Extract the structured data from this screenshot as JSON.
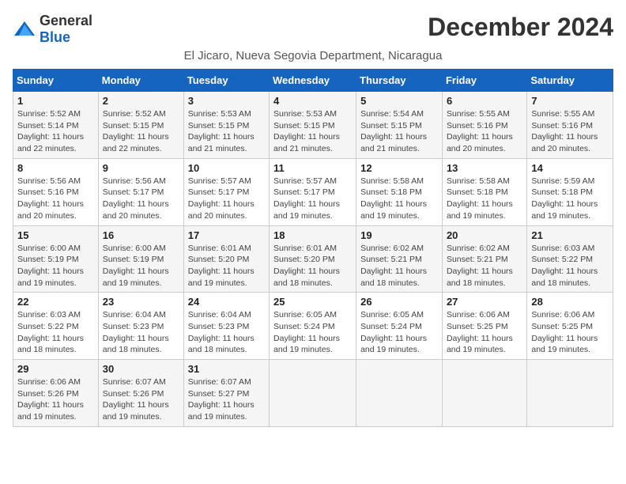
{
  "logo": {
    "general": "General",
    "blue": "Blue"
  },
  "title": "December 2024",
  "subtitle": "El Jicaro, Nueva Segovia Department, Nicaragua",
  "weekdays": [
    "Sunday",
    "Monday",
    "Tuesday",
    "Wednesday",
    "Thursday",
    "Friday",
    "Saturday"
  ],
  "weeks": [
    [
      {
        "day": "1",
        "info": "Sunrise: 5:52 AM\nSunset: 5:14 PM\nDaylight: 11 hours\nand 22 minutes."
      },
      {
        "day": "2",
        "info": "Sunrise: 5:52 AM\nSunset: 5:15 PM\nDaylight: 11 hours\nand 22 minutes."
      },
      {
        "day": "3",
        "info": "Sunrise: 5:53 AM\nSunset: 5:15 PM\nDaylight: 11 hours\nand 21 minutes."
      },
      {
        "day": "4",
        "info": "Sunrise: 5:53 AM\nSunset: 5:15 PM\nDaylight: 11 hours\nand 21 minutes."
      },
      {
        "day": "5",
        "info": "Sunrise: 5:54 AM\nSunset: 5:15 PM\nDaylight: 11 hours\nand 21 minutes."
      },
      {
        "day": "6",
        "info": "Sunrise: 5:55 AM\nSunset: 5:16 PM\nDaylight: 11 hours\nand 20 minutes."
      },
      {
        "day": "7",
        "info": "Sunrise: 5:55 AM\nSunset: 5:16 PM\nDaylight: 11 hours\nand 20 minutes."
      }
    ],
    [
      {
        "day": "8",
        "info": "Sunrise: 5:56 AM\nSunset: 5:16 PM\nDaylight: 11 hours\nand 20 minutes."
      },
      {
        "day": "9",
        "info": "Sunrise: 5:56 AM\nSunset: 5:17 PM\nDaylight: 11 hours\nand 20 minutes."
      },
      {
        "day": "10",
        "info": "Sunrise: 5:57 AM\nSunset: 5:17 PM\nDaylight: 11 hours\nand 20 minutes."
      },
      {
        "day": "11",
        "info": "Sunrise: 5:57 AM\nSunset: 5:17 PM\nDaylight: 11 hours\nand 19 minutes."
      },
      {
        "day": "12",
        "info": "Sunrise: 5:58 AM\nSunset: 5:18 PM\nDaylight: 11 hours\nand 19 minutes."
      },
      {
        "day": "13",
        "info": "Sunrise: 5:58 AM\nSunset: 5:18 PM\nDaylight: 11 hours\nand 19 minutes."
      },
      {
        "day": "14",
        "info": "Sunrise: 5:59 AM\nSunset: 5:18 PM\nDaylight: 11 hours\nand 19 minutes."
      }
    ],
    [
      {
        "day": "15",
        "info": "Sunrise: 6:00 AM\nSunset: 5:19 PM\nDaylight: 11 hours\nand 19 minutes."
      },
      {
        "day": "16",
        "info": "Sunrise: 6:00 AM\nSunset: 5:19 PM\nDaylight: 11 hours\nand 19 minutes."
      },
      {
        "day": "17",
        "info": "Sunrise: 6:01 AM\nSunset: 5:20 PM\nDaylight: 11 hours\nand 19 minutes."
      },
      {
        "day": "18",
        "info": "Sunrise: 6:01 AM\nSunset: 5:20 PM\nDaylight: 11 hours\nand 18 minutes."
      },
      {
        "day": "19",
        "info": "Sunrise: 6:02 AM\nSunset: 5:21 PM\nDaylight: 11 hours\nand 18 minutes."
      },
      {
        "day": "20",
        "info": "Sunrise: 6:02 AM\nSunset: 5:21 PM\nDaylight: 11 hours\nand 18 minutes."
      },
      {
        "day": "21",
        "info": "Sunrise: 6:03 AM\nSunset: 5:22 PM\nDaylight: 11 hours\nand 18 minutes."
      }
    ],
    [
      {
        "day": "22",
        "info": "Sunrise: 6:03 AM\nSunset: 5:22 PM\nDaylight: 11 hours\nand 18 minutes."
      },
      {
        "day": "23",
        "info": "Sunrise: 6:04 AM\nSunset: 5:23 PM\nDaylight: 11 hours\nand 18 minutes."
      },
      {
        "day": "24",
        "info": "Sunrise: 6:04 AM\nSunset: 5:23 PM\nDaylight: 11 hours\nand 18 minutes."
      },
      {
        "day": "25",
        "info": "Sunrise: 6:05 AM\nSunset: 5:24 PM\nDaylight: 11 hours\nand 19 minutes."
      },
      {
        "day": "26",
        "info": "Sunrise: 6:05 AM\nSunset: 5:24 PM\nDaylight: 11 hours\nand 19 minutes."
      },
      {
        "day": "27",
        "info": "Sunrise: 6:06 AM\nSunset: 5:25 PM\nDaylight: 11 hours\nand 19 minutes."
      },
      {
        "day": "28",
        "info": "Sunrise: 6:06 AM\nSunset: 5:25 PM\nDaylight: 11 hours\nand 19 minutes."
      }
    ],
    [
      {
        "day": "29",
        "info": "Sunrise: 6:06 AM\nSunset: 5:26 PM\nDaylight: 11 hours\nand 19 minutes."
      },
      {
        "day": "30",
        "info": "Sunrise: 6:07 AM\nSunset: 5:26 PM\nDaylight: 11 hours\nand 19 minutes."
      },
      {
        "day": "31",
        "info": "Sunrise: 6:07 AM\nSunset: 5:27 PM\nDaylight: 11 hours\nand 19 minutes."
      },
      {
        "day": "",
        "info": ""
      },
      {
        "day": "",
        "info": ""
      },
      {
        "day": "",
        "info": ""
      },
      {
        "day": "",
        "info": ""
      }
    ]
  ]
}
